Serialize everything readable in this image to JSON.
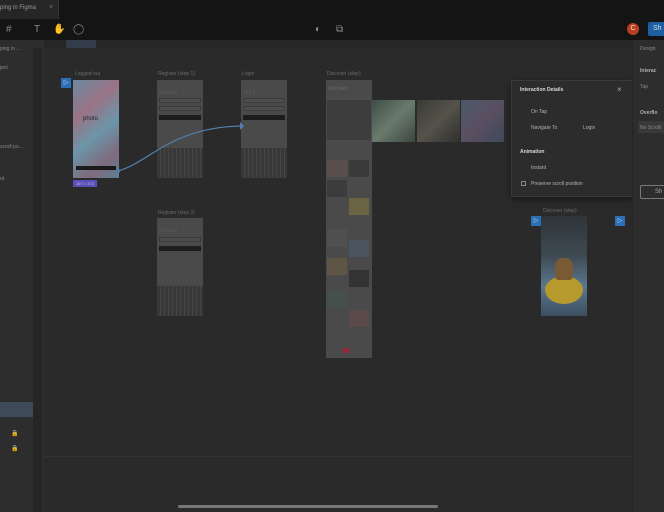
{
  "tab": {
    "title": "ping in Figma",
    "close_icon": "×"
  },
  "toolbar": {
    "frame_tool": "#",
    "pen_tool": "✎",
    "text_tool": "T",
    "hand_tool": "✋",
    "comment_tool": "◯",
    "avatar_initial": "C",
    "share_label": "Sh"
  },
  "left_panel": {
    "items": [
      "ping in ...",
      "ject",
      "scroll po...",
      "ot",
      ""
    ]
  },
  "canvas": {
    "frames": [
      {
        "label": "Logged out"
      },
      {
        "label": "Register (step 1)",
        "title": "Register"
      },
      {
        "label": "Login",
        "title": "Log in"
      },
      {
        "label": "Discover (step)",
        "title": "Discover"
      },
      {
        "label": "Register (step 2)",
        "title": "Register"
      },
      {
        "label": "Discover (step)"
      }
    ],
    "hero_logo": "photo",
    "badge": "167 × 372"
  },
  "interaction_panel": {
    "title": "Interaction Details",
    "trigger": "On Tap",
    "action": "Navigate To",
    "destination": "Login",
    "animation_heading": "Animation",
    "animation_type": "Instant",
    "preserve_scroll": "Preserve scroll position"
  },
  "right_panel": {
    "tab": "Design",
    "heading": "Interac",
    "value": "Tap",
    "overflow_heading": "Overflo",
    "overflow_value": "No Scrolli",
    "button": "Sh"
  },
  "colors": {
    "accent": "#2b6fb6",
    "badge": "#5a4fb7",
    "avatar": "#b8401e"
  }
}
